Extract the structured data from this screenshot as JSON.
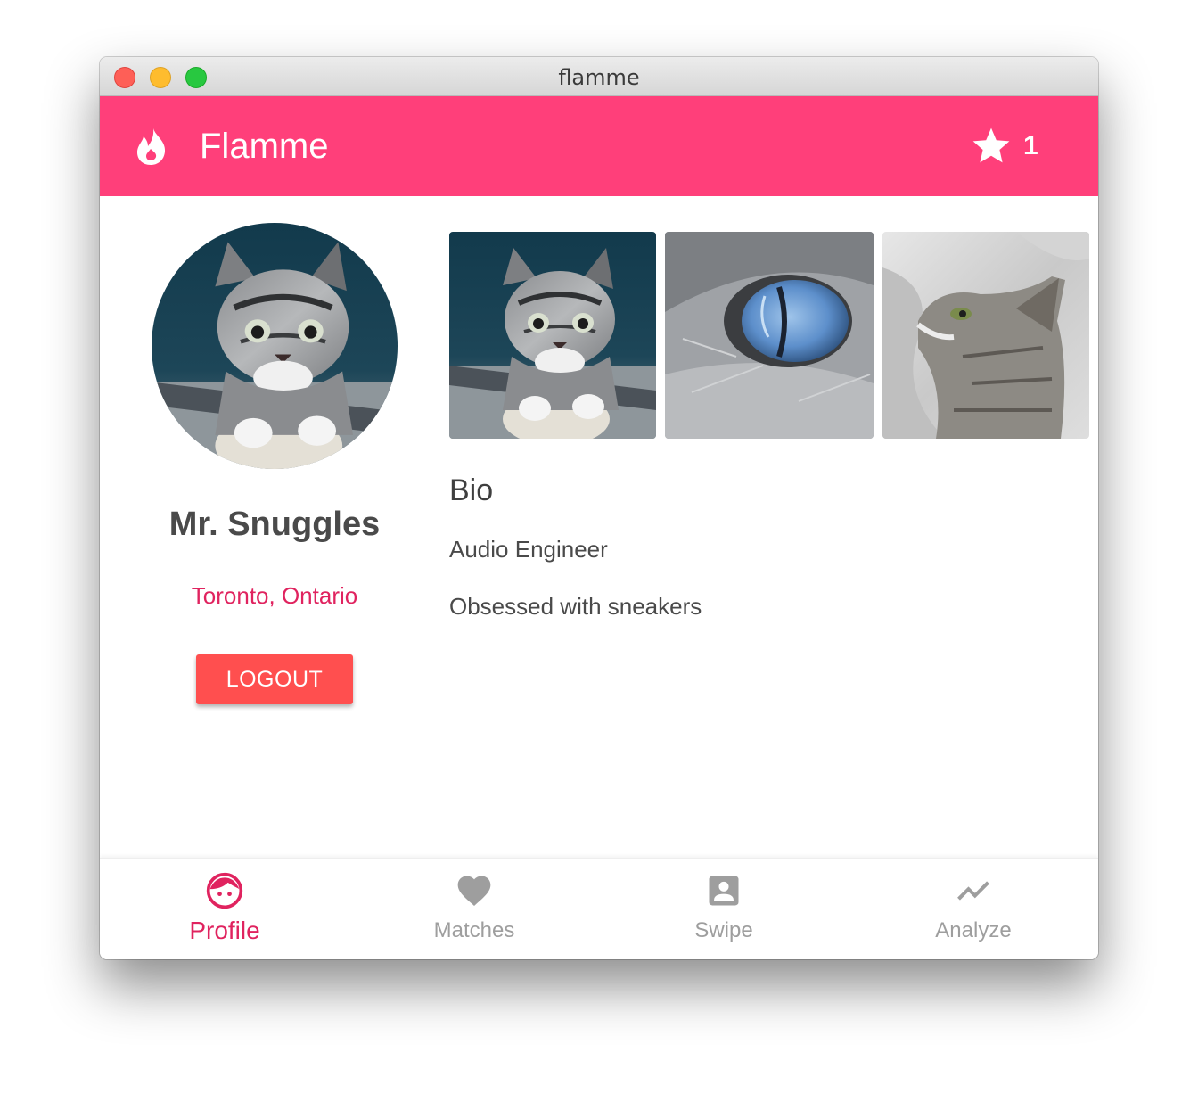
{
  "window": {
    "title": "flamme"
  },
  "appbar": {
    "logo_icon": "flame-icon",
    "app_name": "Flamme",
    "star_icon": "star-icon",
    "star_count": "1",
    "color": "#ff3f7a"
  },
  "profile": {
    "avatar": "kitten-photo",
    "name": "Mr. Snuggles",
    "location": "Toronto, Ontario",
    "logout_label": "LOGOUT",
    "logout_color": "#ff4f4f",
    "accent_color": "#e0235f"
  },
  "photos": [
    {
      "subject": "kitten-photo"
    },
    {
      "subject": "cat-eye-photo"
    },
    {
      "subject": "cat-looking-up-photo"
    }
  ],
  "bio": {
    "heading": "Bio",
    "lines": [
      "Audio Engineer",
      "Obsessed with sneakers"
    ]
  },
  "bottom_nav": {
    "items": [
      {
        "label": "Profile",
        "icon": "face-icon",
        "active": true
      },
      {
        "label": "Matches",
        "icon": "heart-icon",
        "active": false
      },
      {
        "label": "Swipe",
        "icon": "person-card-icon",
        "active": false
      },
      {
        "label": "Analyze",
        "icon": "trending-up-icon",
        "active": false
      }
    ]
  }
}
